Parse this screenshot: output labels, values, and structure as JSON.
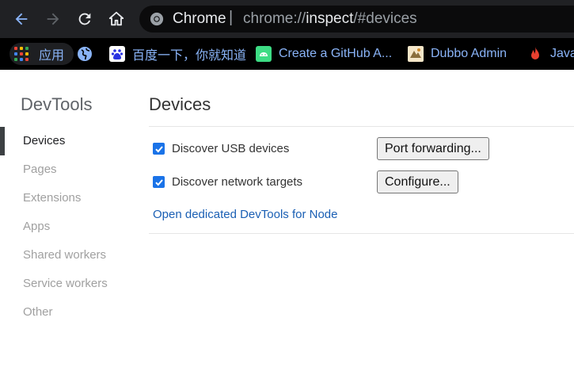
{
  "browser": {
    "omnibox": {
      "site_label": "Chrome",
      "separator": "|",
      "url_scheme": "chrome://",
      "url_host": "inspect",
      "url_rest": "/#devices"
    },
    "bookmarks": [
      {
        "label": "应用",
        "icon": "apps-grid-icon"
      },
      {
        "label": "",
        "icon": "globe-icon"
      },
      {
        "label": "百度一下，你就知道",
        "icon": "baidu-paw-icon"
      },
      {
        "label": "Create a GitHub A...",
        "icon": "android-icon"
      },
      {
        "label": "Dubbo Admin",
        "icon": "dubbo-icon"
      },
      {
        "label": "Java",
        "icon": "flame-icon"
      }
    ]
  },
  "sidebar": {
    "title": "DevTools",
    "items": [
      {
        "label": "Devices",
        "active": true
      },
      {
        "label": "Pages",
        "active": false
      },
      {
        "label": "Extensions",
        "active": false
      },
      {
        "label": "Apps",
        "active": false
      },
      {
        "label": "Shared workers",
        "active": false
      },
      {
        "label": "Service workers",
        "active": false
      },
      {
        "label": "Other",
        "active": false
      }
    ]
  },
  "main": {
    "title": "Devices",
    "options": [
      {
        "label": "Discover USB devices",
        "checked": true,
        "button": "Port forwarding..."
      },
      {
        "label": "Discover network targets",
        "checked": true,
        "button": "Configure..."
      }
    ],
    "node_link": "Open dedicated DevTools for Node"
  },
  "colors": {
    "toolbar_bg": "#202124",
    "bookmarks_bg": "#000000",
    "bookmark_text": "#8ab4f8",
    "checkbox": "#1a73e8",
    "link": "#1a5fb4"
  }
}
